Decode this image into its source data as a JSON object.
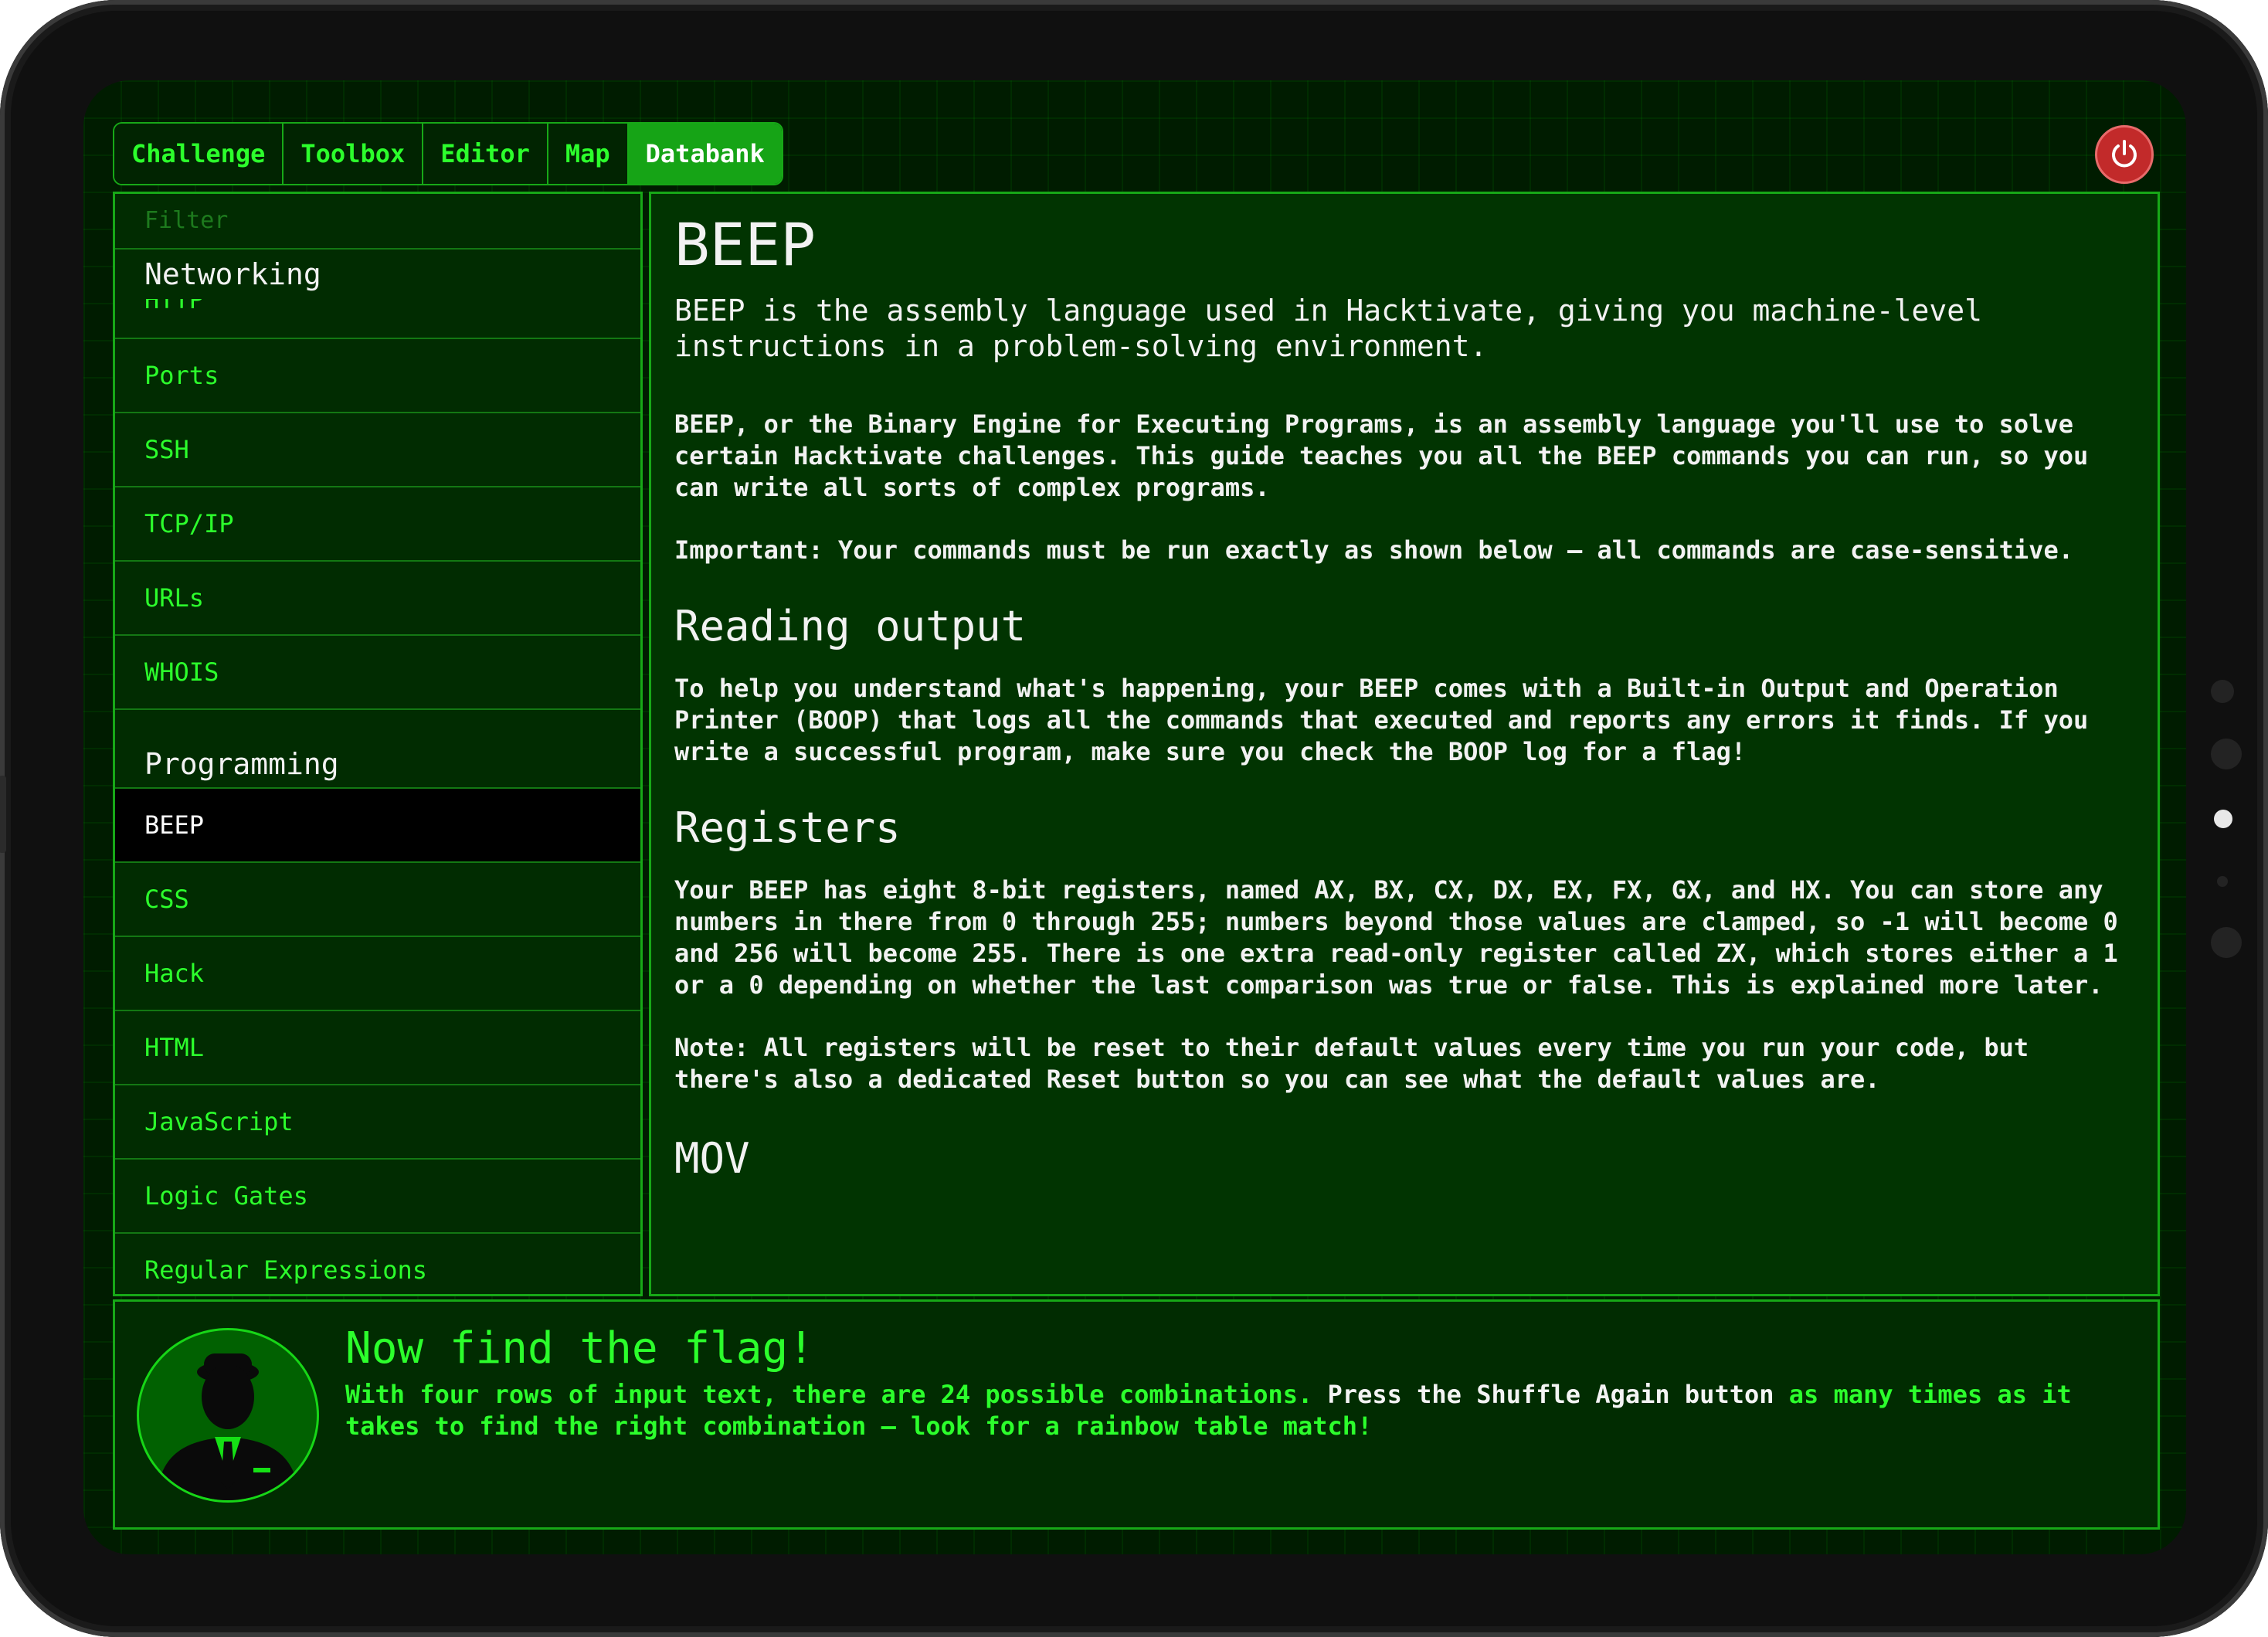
{
  "tabs": [
    {
      "label": "Challenge"
    },
    {
      "label": "Toolbox"
    },
    {
      "label": "Editor"
    },
    {
      "label": "Map"
    },
    {
      "label": "Databank"
    }
  ],
  "active_tab": "Databank",
  "sidebar": {
    "filter_placeholder": "Filter",
    "sections": [
      {
        "title": "Networking",
        "clipped_item": "HTTP",
        "items": [
          "Ports",
          "SSH",
          "TCP/IP",
          "URLs",
          "WHOIS"
        ]
      },
      {
        "title": "Programming",
        "items": [
          "BEEP",
          "CSS",
          "Hack",
          "HTML",
          "JavaScript",
          "Logic Gates",
          "Regular Expressions"
        ]
      }
    ],
    "selected": "BEEP"
  },
  "article": {
    "title": "BEEP",
    "lead": "BEEP is the assembly language used in Hacktivate, giving you machine-level instructions in a problem-solving environment.",
    "intro1": "BEEP, or the Binary Engine for Executing Programs, is an assembly language you'll use to solve certain Hacktivate challenges. This guide teaches you all the BEEP commands you can run, so you can write all sorts of complex programs.",
    "intro2": "Important: Your commands must be run exactly as shown below – all commands are case-sensitive.",
    "reading_title": "Reading output",
    "reading_text": "To help you understand what's happening, your BEEP comes with a Built-in Output and Operation Printer (BOOP) that logs all the commands that executed and reports any errors it finds. If you write a successful program, make sure you check the BOOP log for a flag!",
    "registers_title": "Registers",
    "registers_text": "Your BEEP has eight 8-bit registers, named AX, BX, CX, DX, EX, FX, GX, and HX. You can store any numbers in there from 0 through 255; numbers beyond those values are clamped, so -1 will become 0 and 256 will become 255. There is one extra read-only register called ZX, which stores either a 1 or a 0 depending on whether the last comparison was true or false. This is explained more later.",
    "registers_note": "Note: All registers will be reset to their default values every time you run your code, but there's also a dedicated Reset button so you can see what the default values are.",
    "next_title": "MOV"
  },
  "hint": {
    "title": "Now find the flag!",
    "text_part1": "With four rows of input text, there are 24 possible combinations. ",
    "text_part2": "Press the Shuffle Again button",
    "text_part3": " as many times as it takes to find the right combination – look for a rainbow table match!"
  },
  "colors": {
    "accent": "#2cff2c",
    "border": "#17a817",
    "background": "#001c00",
    "power": "#c22a2a"
  },
  "icons": {
    "power": "power-icon",
    "avatar": "agent-silhouette"
  }
}
